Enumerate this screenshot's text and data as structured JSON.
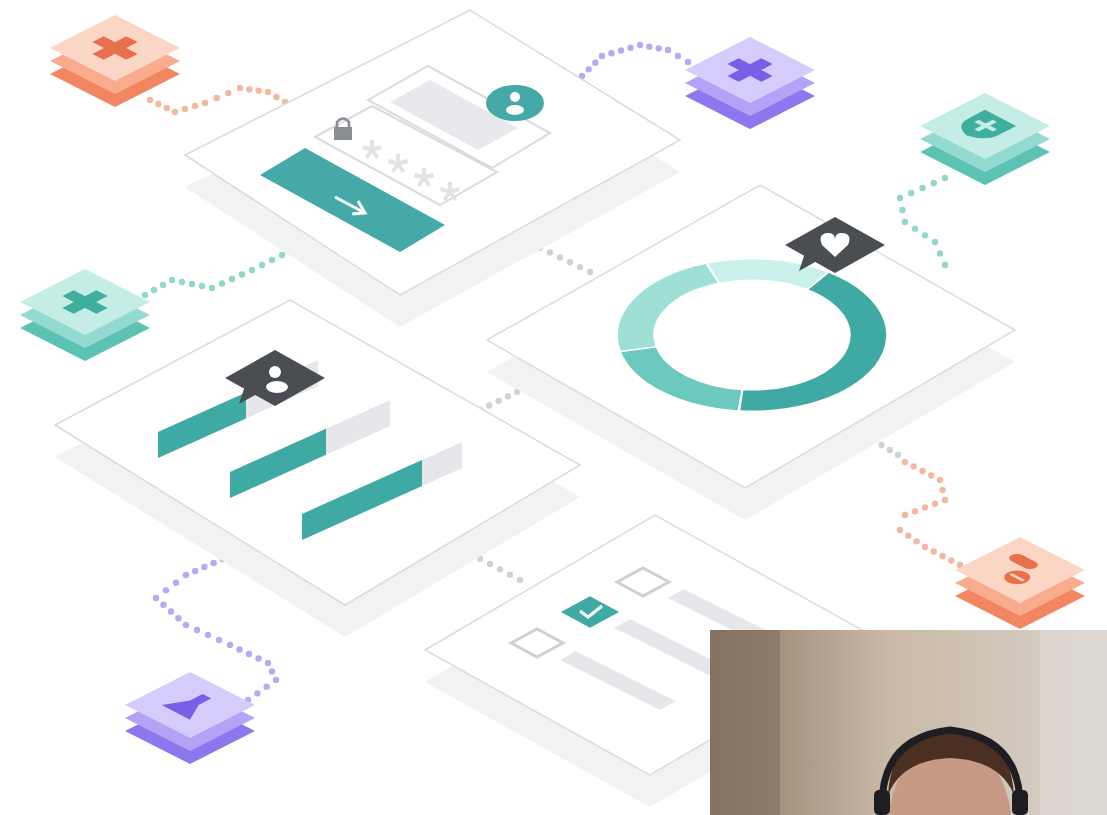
{
  "checklist": [
    {
      "checked": false
    },
    {
      "checked": true
    },
    {
      "checked": false
    }
  ]
}
